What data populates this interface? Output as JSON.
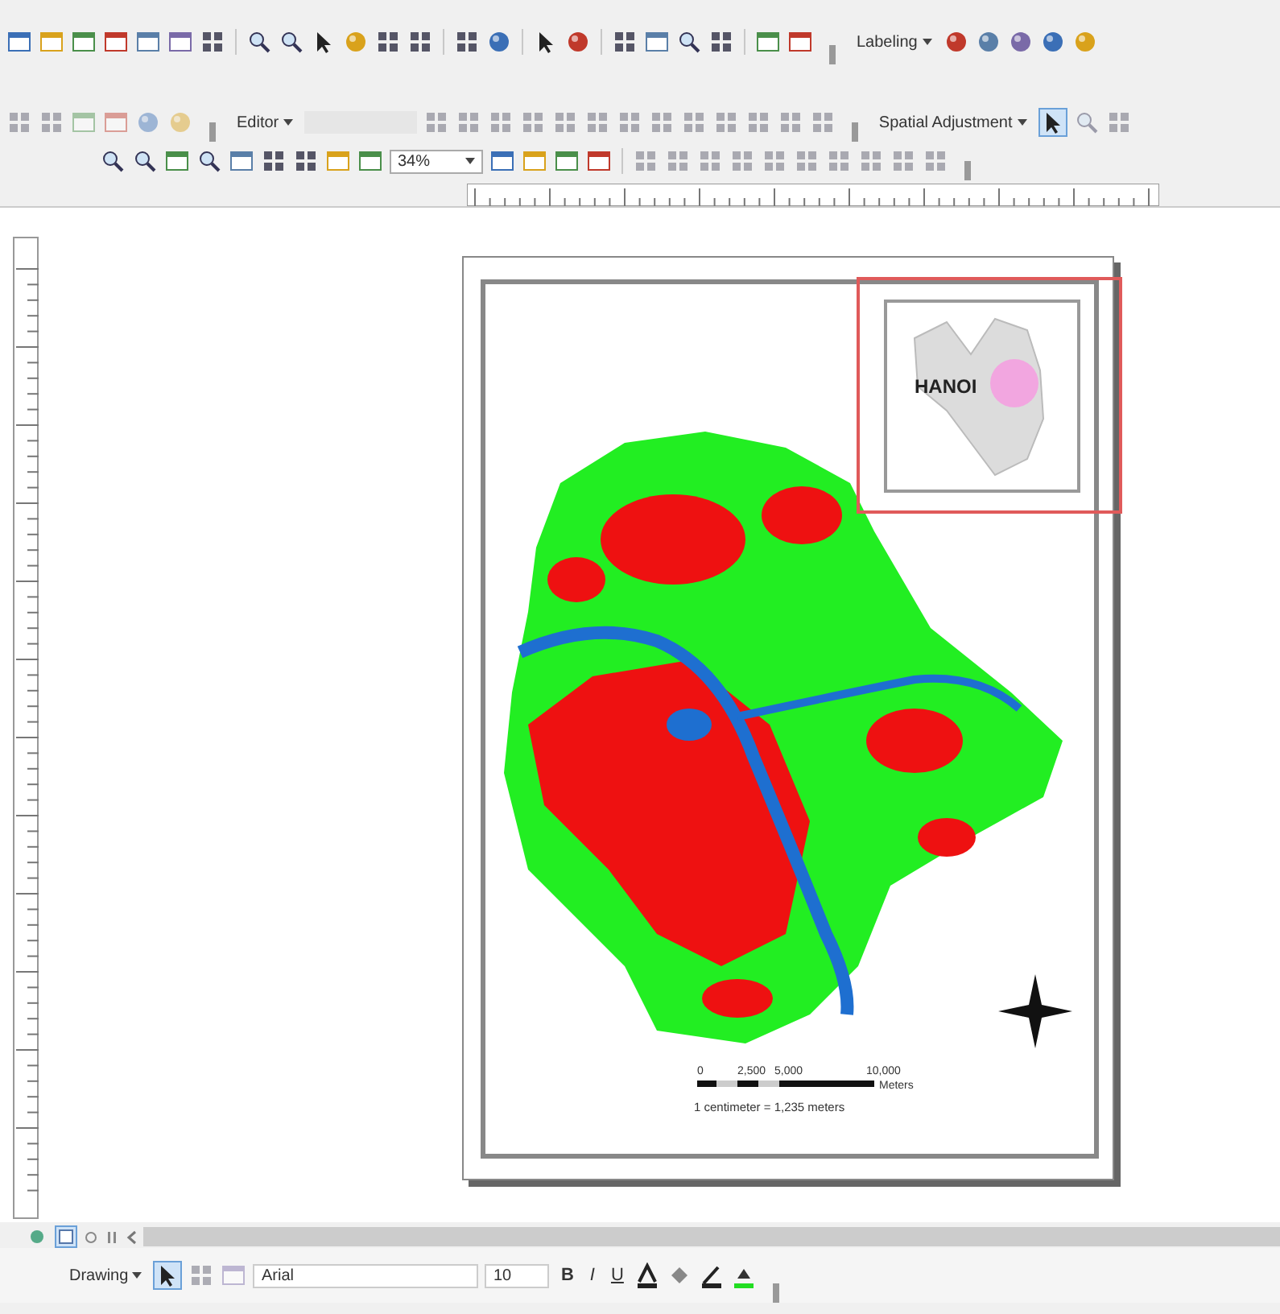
{
  "standard_toolbar": {
    "menu": "Labeling"
  },
  "editor_toolbar": {
    "menu": "Editor"
  },
  "spatial_toolbar": {
    "menu": "Spatial Adjustment"
  },
  "layout_toolbar": {
    "zoom": "34%"
  },
  "layout": {
    "inset_label": "HANOI",
    "scale_labels": [
      "0",
      "2,500",
      "5,000",
      "10,000"
    ],
    "scale_units": "Meters",
    "scale_text": "1 centimeter = 1,235 meters"
  },
  "view_buttons": [
    {
      "selected": false
    },
    {
      "selected": true
    }
  ],
  "drawing_toolbar": {
    "menu": "Drawing",
    "font": "Arial",
    "size": "10",
    "format_buttons": [
      "B",
      "I",
      "U"
    ]
  }
}
